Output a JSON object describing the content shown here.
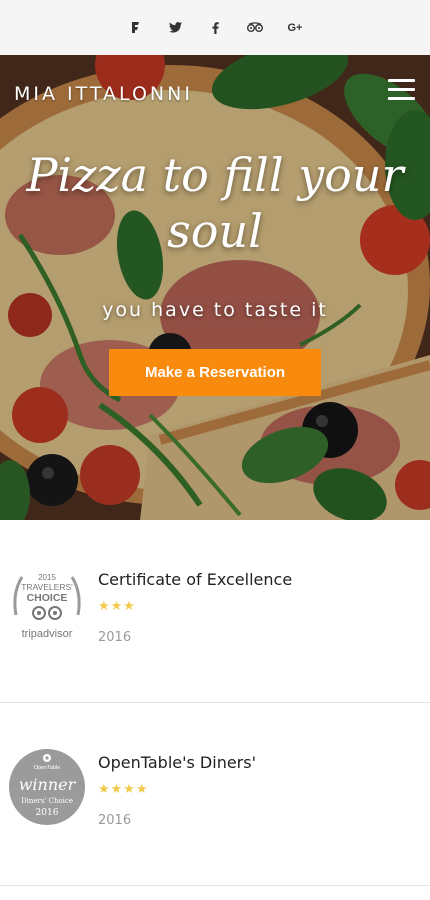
{
  "social": {
    "icons": [
      "foursquare-icon",
      "twitter-icon",
      "facebook-icon",
      "tripadvisor-icon",
      "google-plus-icon"
    ],
    "gplus_label": "G+"
  },
  "header": {
    "brand": "MIA ITTALONNI",
    "menu_icon": "hamburger-menu-icon"
  },
  "hero": {
    "headline_line1": "Pizza to fill your",
    "headline_line2": "soul",
    "subline": "you have to taste it",
    "cta_label": "Make a Reservation"
  },
  "awards": [
    {
      "badge_year": "2015",
      "badge_line1": "TRAVELERS'",
      "badge_line2": "CHOICE",
      "badge_brand": "tripadvisor",
      "title": "Certificate of Excellence",
      "stars": "★★★",
      "year": "2016"
    },
    {
      "badge_top": "OpenTable",
      "badge_main": "winner",
      "badge_sub": "Diners' Choice",
      "badge_year": "2016",
      "title": "OpenTable's Diners'",
      "stars": "★★★★",
      "year": "2016"
    }
  ],
  "colors": {
    "accent": "#f88b0e",
    "star": "#f2c94c",
    "muted_text": "#9a9a9a",
    "social_bar_bg": "#f5f5f5"
  }
}
